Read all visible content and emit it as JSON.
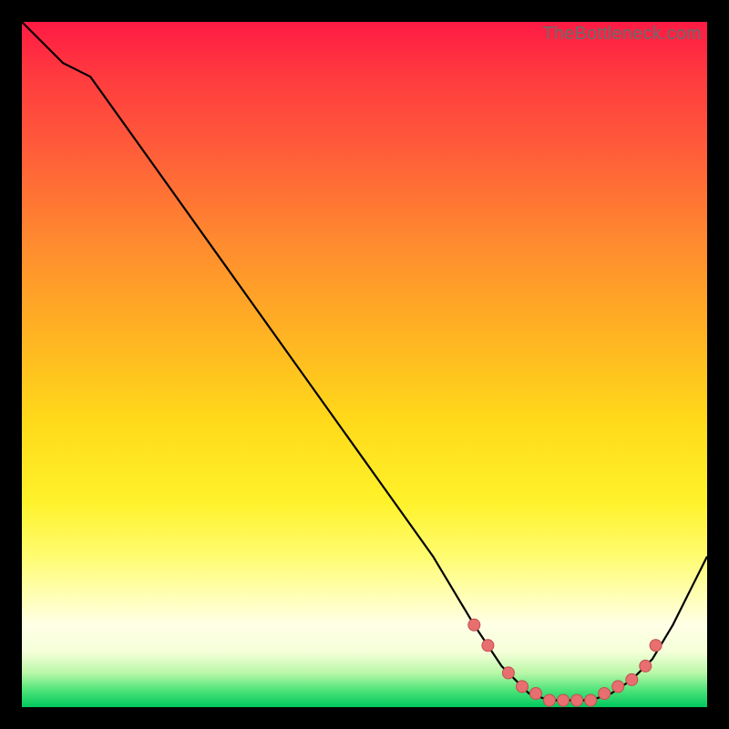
{
  "watermark": "TheBottleneck.com",
  "colors": {
    "curve_stroke": "#000000",
    "marker_fill": "#e86f6f",
    "marker_stroke": "#c24f4f"
  },
  "chart_data": {
    "type": "line",
    "title": "",
    "xlabel": "",
    "ylabel": "",
    "xlim": [
      0,
      100
    ],
    "ylim": [
      0,
      100
    ],
    "grid": false,
    "legend": false,
    "series": [
      {
        "name": "bottleneck-curve",
        "x": [
          0,
          6,
          10,
          20,
          30,
          40,
          50,
          60,
          66,
          70,
          74,
          77,
          80,
          83,
          86,
          89,
          92,
          95,
          100
        ],
        "values": [
          100,
          94,
          92,
          78,
          64,
          50,
          36,
          22,
          12,
          6,
          2,
          1,
          1,
          1,
          2,
          4,
          7,
          12,
          22
        ]
      }
    ],
    "markers": {
      "name": "highlight-dots",
      "x": [
        66,
        68,
        71,
        73,
        75,
        77,
        79,
        81,
        83,
        85,
        87,
        89,
        91,
        92.5
      ],
      "values": [
        12,
        9,
        5,
        3,
        2,
        1,
        1,
        1,
        1,
        2,
        3,
        4,
        6,
        9
      ]
    }
  }
}
